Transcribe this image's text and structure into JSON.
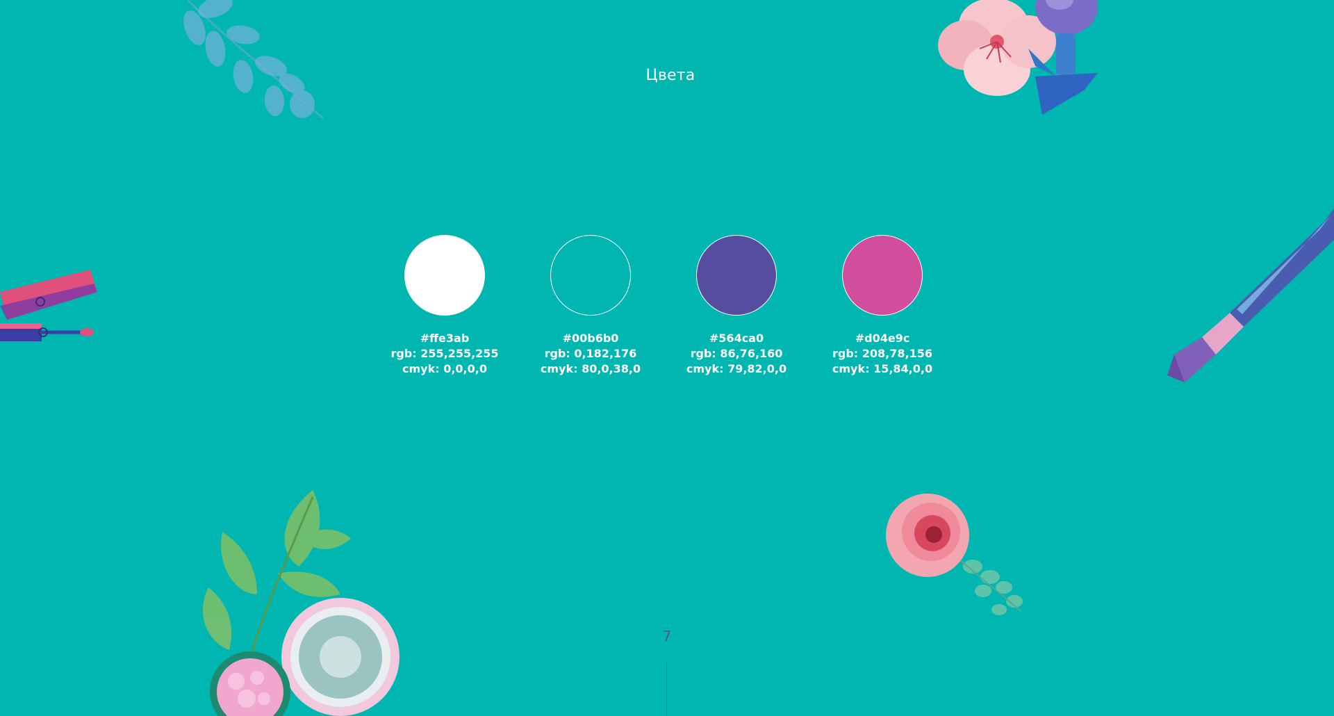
{
  "page": {
    "title": "Цвета",
    "number": "7",
    "background": "#00b6b0"
  },
  "swatches": [
    {
      "fill": "#ffffff",
      "outline": false,
      "hex": "#ffe3ab",
      "rgb": "rgb: 255,255,255",
      "cmyk": "cmyk: 0,0,0,0"
    },
    {
      "fill": "#00b6b0",
      "outline": true,
      "hex": "#00b6b0",
      "rgb": "rgb: 0,182,176",
      "cmyk": "cmyk: 80,0,38,0"
    },
    {
      "fill": "#564ca0",
      "outline": true,
      "hex": "#564ca0",
      "rgb": "rgb: 86,76,160",
      "cmyk": "cmyk: 79,82,0,0"
    },
    {
      "fill": "#d04e9c",
      "outline": true,
      "hex": "#d04e9c",
      "rgb": "rgb: 208,78,156",
      "cmyk": "cmyk: 15,84,0,0"
    }
  ],
  "decorations": {
    "leaf_branch_top_left": "leaf-branch-icon",
    "flower_and_bottle_top_right": "flower-icon",
    "lip_gloss_left": "lip-gloss-icon",
    "makeup_brush_right": "makeup-brush-icon",
    "powder_compact_bottom_left": "powder-compact-icon",
    "rose_bottom_right": "rose-icon"
  }
}
